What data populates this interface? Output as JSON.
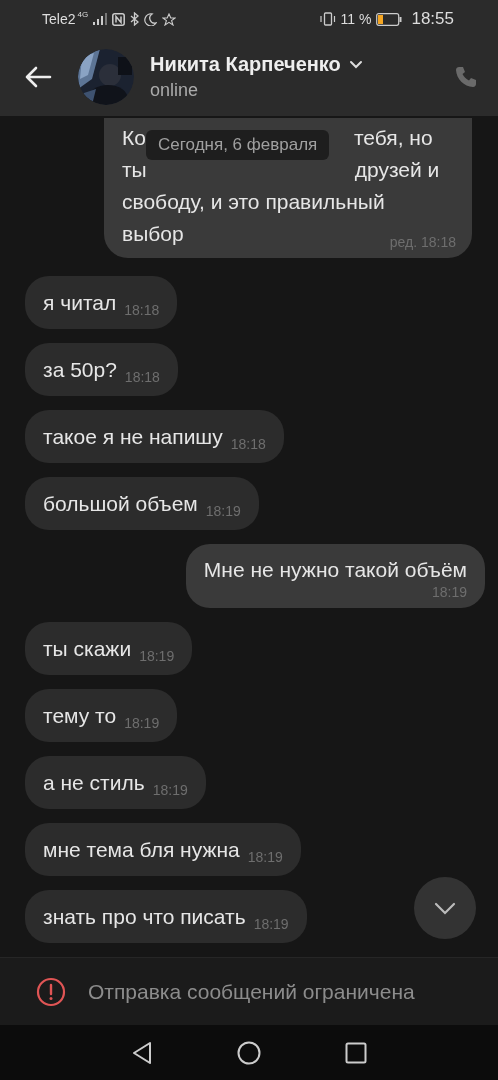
{
  "status_bar": {
    "carrier": "Tele2",
    "network": "4G",
    "battery": "11 %",
    "time": "18:55"
  },
  "header": {
    "name": "Никита Карпеченко",
    "status": "online"
  },
  "date_label": "Сегодня, 6 февраля",
  "messages": [
    {
      "kind": "outgoing",
      "lines": [
        [
          "Ко",
          "тебя, но"
        ],
        [
          "ты",
          "друзей и"
        ],
        [
          "свободу, и это правильный"
        ],
        [
          "выбор"
        ]
      ],
      "time": "ред. 18:18"
    },
    {
      "kind": "incoming",
      "lines": [
        "я читал"
      ],
      "time": "18:18"
    },
    {
      "kind": "incoming",
      "lines": [
        "за 50р?"
      ],
      "time": "18:18"
    },
    {
      "kind": "incoming",
      "lines": [
        "такое я не напишу"
      ],
      "time": "18:18"
    },
    {
      "kind": "incoming",
      "lines": [
        "большой объем"
      ],
      "time": "18:19"
    },
    {
      "kind": "outgoing",
      "lines": [
        [
          "Мне не нужно такой объём"
        ]
      ],
      "time": "18:19"
    },
    {
      "kind": "incoming",
      "lines": [
        "ты скажи"
      ],
      "time": "18:19"
    },
    {
      "kind": "incoming",
      "lines": [
        "тему то"
      ],
      "time": "18:19"
    },
    {
      "kind": "incoming",
      "lines": [
        "а не стиль"
      ],
      "time": "18:19"
    },
    {
      "kind": "incoming",
      "lines": [
        "мне тема бля нужна"
      ],
      "time": "18:19"
    },
    {
      "kind": "incoming",
      "lines": [
        "знать про что писать"
      ],
      "time": "18:19"
    }
  ],
  "notice": "Отправка сообщений ограничена"
}
